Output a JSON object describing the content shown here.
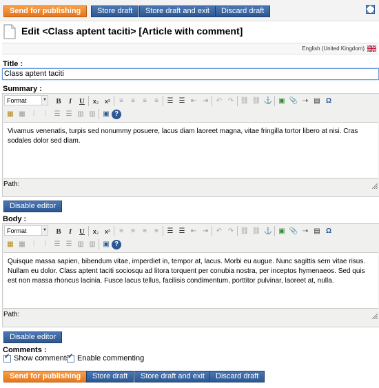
{
  "toolbar_top": {
    "send": "Send for publishing",
    "store": "Store draft",
    "store_exit": "Store draft and exit",
    "discard": "Discard draft"
  },
  "header": {
    "title": "Edit <Class aptent taciti> [Article with comment]",
    "language": "English (United Kingdom)"
  },
  "title_field": {
    "label": "Title :",
    "value": "Class aptent taciti"
  },
  "summary": {
    "label": "Summary :",
    "format": "Format",
    "content": "Vivamus venenatis, turpis sed nonummy posuere, lacus diam laoreet magna, vitae fringilla tortor libero at nisi. Cras sodales dolor sed diam.",
    "path": "Path:",
    "disable": "Disable editor"
  },
  "body": {
    "label": "Body :",
    "format": "Format",
    "content": "Quisque massa sapien, bibendum vitae, imperdiet in, tempor at, lacus. Morbi eu augue. Nunc sagittis sem vitae risus. Nullam eu dolor. Class aptent taciti sociosqu ad litora torquent per conubia nostra, per inceptos hymenaeos. Sed quis est non massa rhoncus lacinia. Fusce lacus tellus, facilisis condimentum, porttitor pulvinar, laoreet at, nulla.",
    "path": "Path:",
    "disable": "Disable editor"
  },
  "comments": {
    "label": "Comments :",
    "show": "Show comments",
    "enable": "Enable commenting"
  },
  "toolbar_bottom": {
    "send": "Send for publishing",
    "store": "Store draft",
    "store_exit": "Store draft and exit",
    "discard": "Discard draft"
  },
  "colors": {
    "accent": "#e8751a",
    "primary": "#2c5791"
  }
}
